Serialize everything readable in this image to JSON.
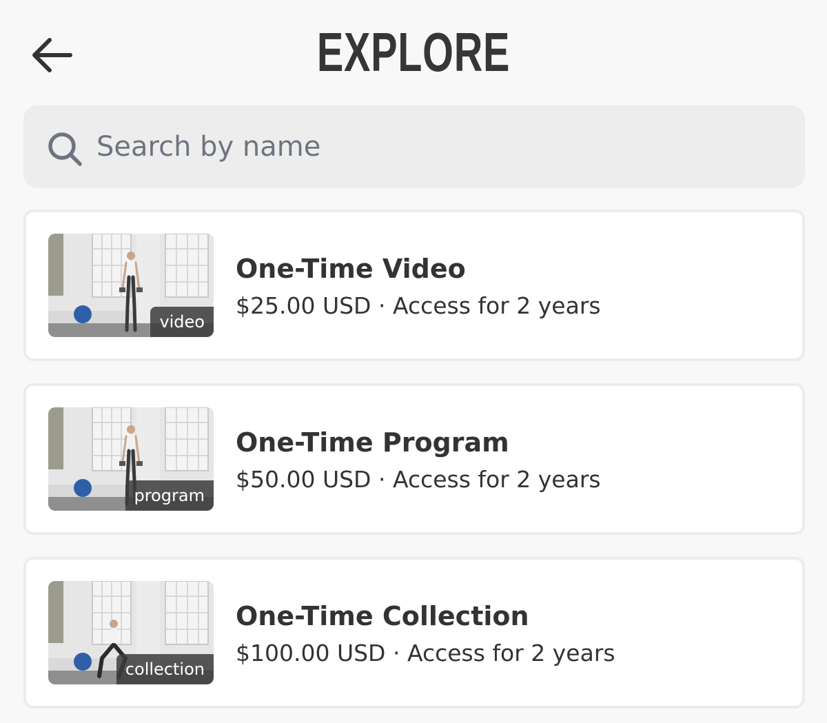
{
  "header": {
    "title": "EXPLORE",
    "back_icon": "arrow-left-icon"
  },
  "search": {
    "placeholder": "Search by name",
    "value": "",
    "icon": "search-icon"
  },
  "items": [
    {
      "title": "One-Time Video",
      "price": "$25.00 USD",
      "separator": " · ",
      "access": "Access for 2 years",
      "tag": "video",
      "pose": "standing"
    },
    {
      "title": "One-Time Program",
      "price": "$50.00 USD",
      "separator": " · ",
      "access": "Access for 2 years",
      "tag": "program",
      "pose": "standing"
    },
    {
      "title": "One-Time Collection",
      "price": "$100.00 USD",
      "separator": " · ",
      "access": "Access for 2 years",
      "tag": "collection",
      "pose": "lunge"
    }
  ],
  "colors": {
    "background": "#f8f8f8",
    "card": "#ffffff",
    "search_bg": "#ededed",
    "text": "#333333",
    "placeholder": "#6e7480",
    "ball": "#2f5fa8"
  }
}
